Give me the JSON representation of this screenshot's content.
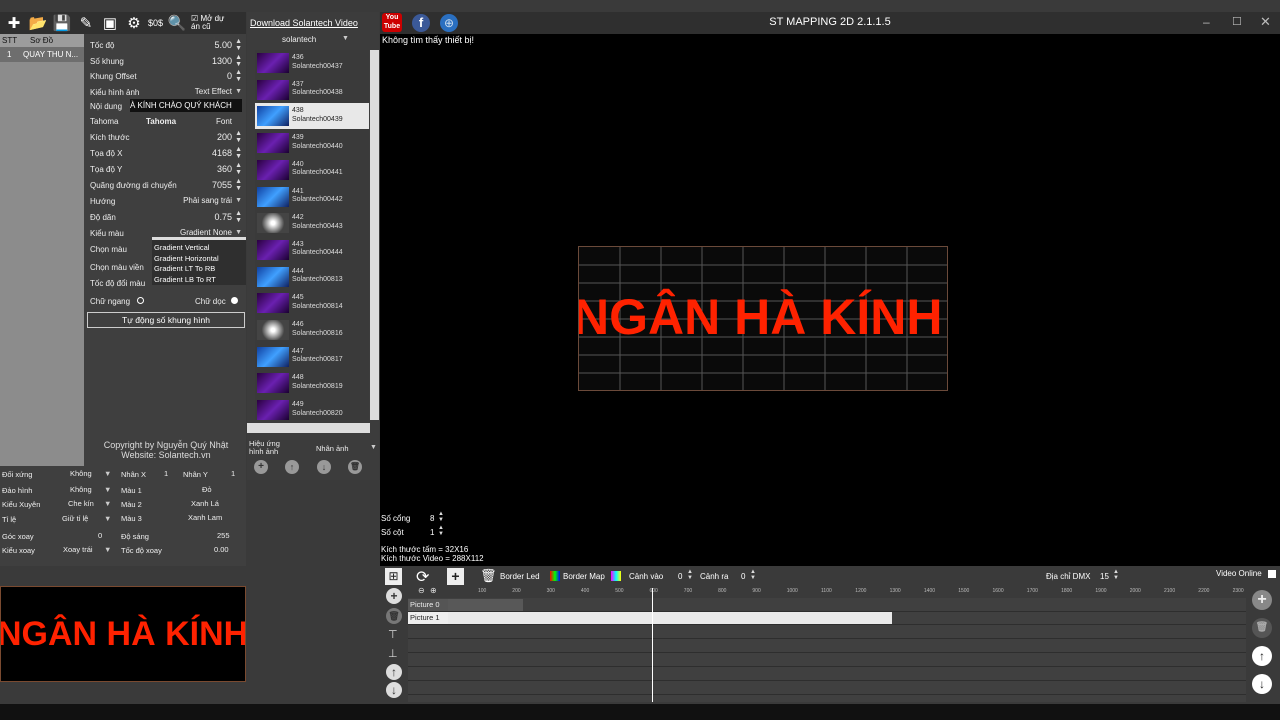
{
  "toolbar": {
    "sos_label": "$0$",
    "checkbox_label": "Mở dự án cũ"
  },
  "download_link": "Download Solantech Video",
  "channel_select": "solantech",
  "window_title": "ST MAPPING 2D 2.1.1.5",
  "error_text": "Không tìm thấy thiết bị!",
  "stt_panel": {
    "col_stt": "STT",
    "col_sodo": "Sơ Đồ",
    "row_num": "1",
    "row_name": "QUAY THU N..."
  },
  "props": {
    "toc_do": {
      "label": "Tốc độ",
      "value": "5.00"
    },
    "so_khung": {
      "label": "Số khung",
      "value": "1300"
    },
    "khung_offset": {
      "label": "Khung Offset",
      "value": "0"
    },
    "kieu_hinh_anh": {
      "label": "Kiểu hình ảnh",
      "value": "Text Effect"
    },
    "noi_dung": {
      "label": "Nội dung",
      "value": "À KÍNH CHÀO QUÝ KHÁCH"
    },
    "font": {
      "label": "Tahoma",
      "value": "Tahoma",
      "button": "Font"
    },
    "kich_thuoc": {
      "label": "Kích thước",
      "value": "200"
    },
    "toa_do_x": {
      "label": "Tọa độ X",
      "value": "4168"
    },
    "toa_do_y": {
      "label": "Tọa độ Y",
      "value": "360"
    },
    "quang_duong": {
      "label": "Quãng đường di chuyển",
      "value": "7055"
    },
    "huong": {
      "label": "Hướng",
      "value": "Phải sang trái"
    },
    "do_dan": {
      "label": "Độ dãn",
      "value": "0.75"
    },
    "kieu_mau": {
      "label": "Kiểu màu",
      "value": "Gradient None"
    },
    "chon_mau": {
      "label": "Chọn màu"
    },
    "chon_mau_vien": {
      "label": "Chọn màu viền"
    },
    "toc_do_doi_mau": {
      "label": "Tốc độ đổi màu"
    },
    "chu_ngang": "Chữ ngang",
    "chu_doc": "Chữ dọc",
    "auto_button": "Tự động số khung hình"
  },
  "gradient_options": [
    "Gradient Vertical",
    "Gradient Horizontal",
    "Gradient LT To RB",
    "Gradient LB To RT"
  ],
  "copyright": {
    "line1": "Copyright by Nguyễn Quý Nhật",
    "line2": "Website: Solantech.vn"
  },
  "props2": {
    "doi_xung": {
      "label": "Đối xứng",
      "value": "Không"
    },
    "dao_hinh": {
      "label": "Đảo hình",
      "value": "Không"
    },
    "kieu_xuyen": {
      "label": "Kiểu Xuyên",
      "value": "Che kín"
    },
    "ti_le": {
      "label": "Tỉ lệ",
      "value": "Giữ tỉ lệ"
    },
    "goc_xoay": {
      "label": "Góc xoay",
      "value": "0"
    },
    "kieu_xoay": {
      "label": "Kiểu xoay",
      "value": "Xoay trái"
    },
    "nhan_x": {
      "label": "Nhân X",
      "value": "1"
    },
    "nhan_y": {
      "label": "Nhân Y",
      "value": "1"
    },
    "mau1": {
      "label": "Màu 1",
      "value": "Đỏ"
    },
    "mau2": {
      "label": "Màu 2",
      "value": "Xanh Lá"
    },
    "mau3": {
      "label": "Màu 3",
      "value": "Xanh Lam"
    },
    "do_sang": {
      "label": "Độ sáng",
      "value": "255"
    },
    "toc_do_xoay": {
      "label": "Tốc độ xoay",
      "value": "0.00"
    }
  },
  "preview_text": "NGÂN HÀ KÍNH",
  "effects": [
    {
      "num": "436",
      "name": "Solantech00437"
    },
    {
      "num": "437",
      "name": "Solantech00438"
    },
    {
      "num": "438",
      "name": "Solantech00439"
    },
    {
      "num": "439",
      "name": "Solantech00440"
    },
    {
      "num": "440",
      "name": "Solantech00441"
    },
    {
      "num": "441",
      "name": "Solantech00442"
    },
    {
      "num": "442",
      "name": "Solantech00443"
    },
    {
      "num": "443",
      "name": "Solantech00444"
    },
    {
      "num": "444",
      "name": "Solantech00813"
    },
    {
      "num": "445",
      "name": "Solantech00814"
    },
    {
      "num": "446",
      "name": "Solantech00816"
    },
    {
      "num": "447",
      "name": "Solantech00817"
    },
    {
      "num": "448",
      "name": "Solantech00819"
    },
    {
      "num": "449",
      "name": "Solantech00820"
    }
  ],
  "effect_selected_index": 2,
  "effect_panel": {
    "label": "Hiệu ứng hình ảnh",
    "select": "Nhân ảnh"
  },
  "canvas_info": {
    "so_cong_label": "Số cổng",
    "so_cong": "8",
    "so_cot_label": "Số cột",
    "so_cot": "1",
    "kt_tam": "Kích thước tấm = 32X16",
    "kt_video": "Kích thước Video = 288X112"
  },
  "led_text": "NGÂN HÀ KÍNH",
  "timeline_bar": {
    "border_led": "Border Led",
    "border_map": "Border Map",
    "canh_vao": "Cảnh vào",
    "canh_vao_val": "0",
    "canh_ra": "Cảnh ra",
    "canh_ra_val": "0",
    "dia_chi_dmx": "Địa chỉ DMX",
    "dmx_val": "15",
    "video_online": "Video Online"
  },
  "ruler": [
    "100",
    "200",
    "300",
    "400",
    "500",
    "600",
    "700",
    "800",
    "900",
    "1000",
    "1100",
    "1200",
    "1300",
    "1400",
    "1500",
    "1600",
    "1700",
    "1800",
    "1900",
    "2000",
    "2100",
    "2200",
    "2300"
  ],
  "tracks": [
    "Picture 0",
    "Picture 1"
  ],
  "colors": {
    "accent_red": "#ff2200",
    "panel": "#3f3f3f",
    "canvas": "#000000"
  }
}
